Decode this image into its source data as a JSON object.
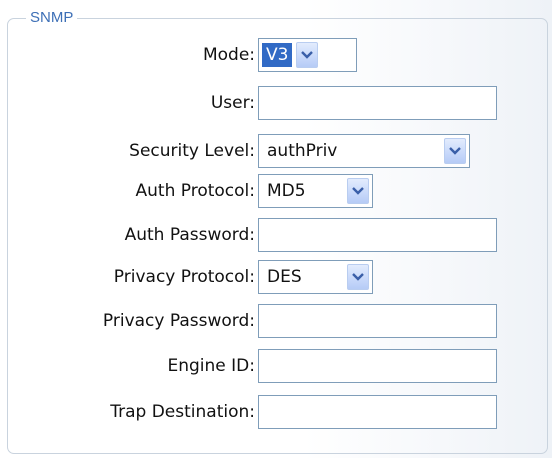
{
  "section": {
    "legend": "SNMP"
  },
  "fields": {
    "mode": {
      "label": "Mode:",
      "value": "V3"
    },
    "user": {
      "label": "User:",
      "value": ""
    },
    "security_level": {
      "label": "Security Level:",
      "value": "authPriv"
    },
    "auth_protocol": {
      "label": "Auth Protocol:",
      "value": "MD5"
    },
    "auth_password": {
      "label": "Auth Password:",
      "value": ""
    },
    "privacy_protocol": {
      "label": "Privacy Protocol:",
      "value": "DES"
    },
    "privacy_password": {
      "label": "Privacy Password:",
      "value": ""
    },
    "engine_id": {
      "label": "Engine ID:",
      "value": ""
    },
    "trap_destination": {
      "label": "Trap Destination:",
      "value": ""
    }
  },
  "icons": {
    "dropdown": "chevron-down-icon"
  },
  "colors": {
    "legend": "#3d6fb6",
    "border": "#7f9db9",
    "selection": "#316ac5"
  }
}
